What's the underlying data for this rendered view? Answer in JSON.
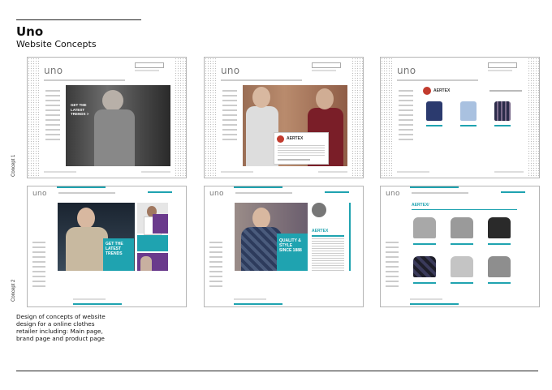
{
  "header": {
    "title": "Uno",
    "subtitle": "Website Concepts"
  },
  "side_labels": {
    "concept1": "Concept 1",
    "concept2": "Concept 2"
  },
  "description": "Design of concepts of website design for a online clothes retailer including: Main page, brand page and product page",
  "concept1": {
    "logo": "uno",
    "home_overlay": "GET THE LATEST TRENDS >",
    "brand_name": "AERTEX"
  },
  "concept2": {
    "logo": "uno",
    "home_promo": "GET THE LATEST TRENDS",
    "brand_promo": "QUALITY & STYLE SINCE 1888",
    "brand_name": "AERTEX",
    "product_heading": "AERTEX/"
  },
  "colors": {
    "accent": "#1fa3b0",
    "purple": "#6a3a8c",
    "brand_red": "#c23b2e"
  }
}
